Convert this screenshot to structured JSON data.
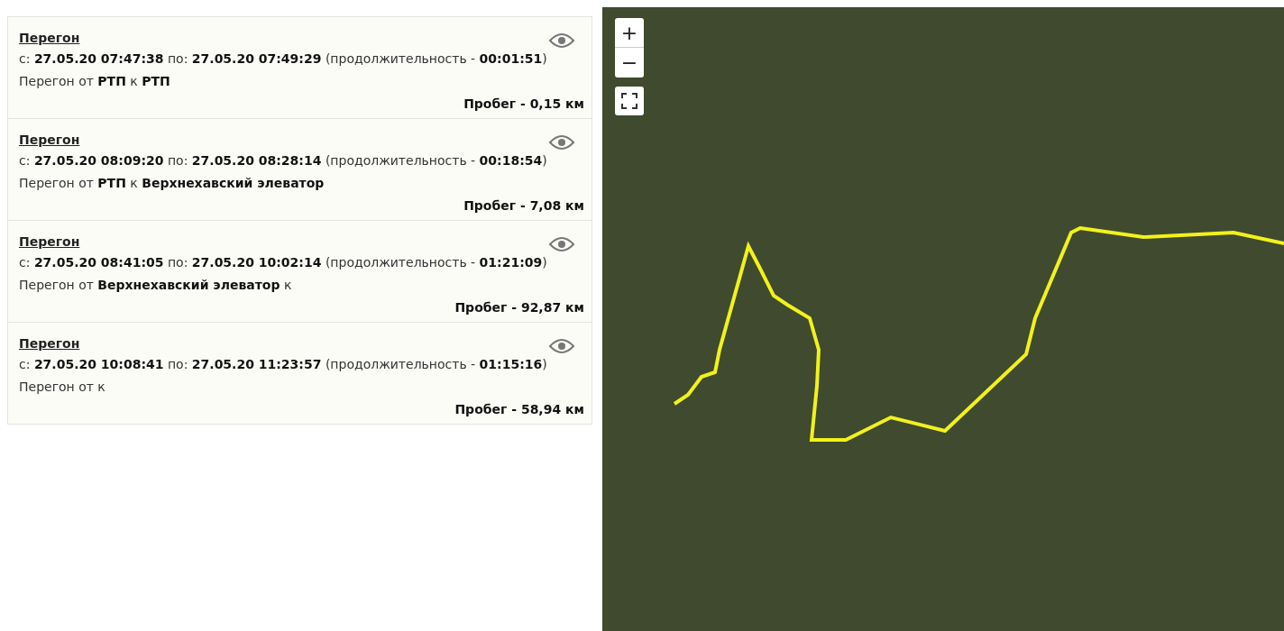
{
  "segments": [
    {
      "title": "Перегон",
      "period": "с: **27.05.20 07:47:38** по: **27.05.20 07:49:29** (продолжительность - **00:01:51**)",
      "route": "Перегон от **РТП** к **РТП**",
      "mileage": "Пробег - 0,15 км"
    },
    {
      "title": "Перегон",
      "period": "с: **27.05.20 08:09:20** по: **27.05.20 08:28:14** (продолжительность - **00:18:54**)",
      "route": "Перегон от **РТП** к **Верхнехавский элеватор**",
      "mileage": "Пробег - 7,08 км"
    },
    {
      "title": "Перегон",
      "period": "с: **27.05.20 08:41:05** по: **27.05.20 10:02:14** (продолжительность - **01:21:09**)",
      "route": "Перегон от **Верхнехавский элеватор** к",
      "mileage": "Пробег - 92,87 км"
    },
    {
      "title": "Перегон",
      "period": "с: **27.05.20 10:08:41** по: **27.05.20 11:23:57** (продолжительность - **01:15:16**)",
      "route": "Перегон от к",
      "mileage": "Пробег - 58,94 км"
    }
  ],
  "map": {
    "zoom_in": "+",
    "zoom_out": "−"
  }
}
